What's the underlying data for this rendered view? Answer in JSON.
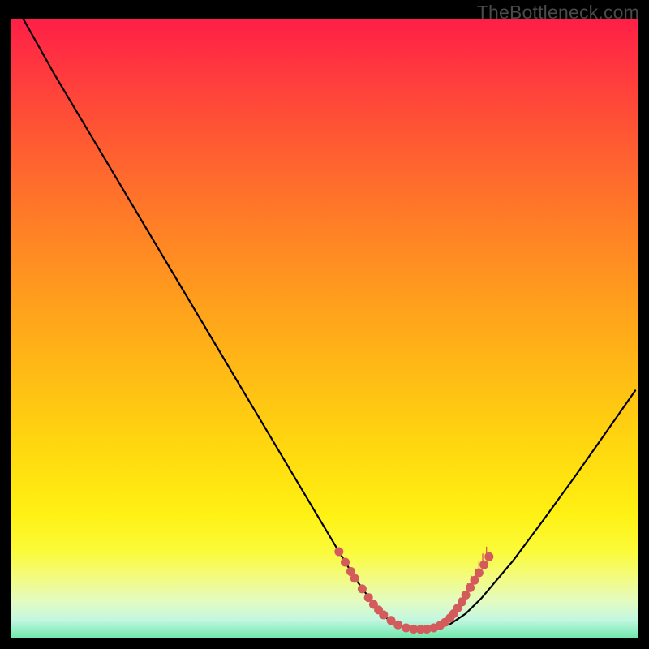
{
  "watermark": {
    "text": "TheBottleneck.com"
  },
  "chart_data": {
    "type": "line",
    "title": "",
    "xlabel": "",
    "ylabel": "",
    "xlim": [
      0,
      100
    ],
    "ylim": [
      0,
      100
    ],
    "series": [
      {
        "name": "curve",
        "x": [
          2,
          7,
          12,
          17,
          22,
          27,
          32,
          37,
          42,
          47,
          52,
          55,
          58,
          60,
          62,
          64,
          67,
          70,
          72.5,
          75,
          80,
          85,
          90,
          95,
          99.5
        ],
        "values": [
          100,
          91,
          82.5,
          74,
          65.5,
          57,
          48.5,
          40,
          31.5,
          23,
          14.5,
          9.5,
          5.3,
          3.2,
          2.0,
          1.5,
          1.5,
          2.3,
          4.0,
          6.5,
          12.5,
          19.3,
          26.3,
          33.5,
          40.0
        ]
      }
    ],
    "markers": {
      "name": "dots",
      "color": "#d45b5b",
      "points": [
        {
          "x": 52.3,
          "y": 14.0
        },
        {
          "x": 53.3,
          "y": 12.3
        },
        {
          "x": 54.2,
          "y": 10.8
        },
        {
          "x": 54.8,
          "y": 9.7
        },
        {
          "x": 56.0,
          "y": 8.0
        },
        {
          "x": 57.0,
          "y": 6.6
        },
        {
          "x": 57.8,
          "y": 5.5
        },
        {
          "x": 58.6,
          "y": 4.6
        },
        {
          "x": 59.4,
          "y": 3.8
        },
        {
          "x": 60.6,
          "y": 2.9
        },
        {
          "x": 61.7,
          "y": 2.2
        },
        {
          "x": 63.0,
          "y": 1.7
        },
        {
          "x": 64.2,
          "y": 1.5
        },
        {
          "x": 65.3,
          "y": 1.45
        },
        {
          "x": 66.3,
          "y": 1.5
        },
        {
          "x": 67.4,
          "y": 1.7
        },
        {
          "x": 68.4,
          "y": 2.1
        },
        {
          "x": 69.2,
          "y": 2.6
        },
        {
          "x": 70.0,
          "y": 3.3
        },
        {
          "x": 70.6,
          "y": 4.0
        },
        {
          "x": 71.2,
          "y": 4.9
        },
        {
          "x": 71.9,
          "y": 5.9
        },
        {
          "x": 72.5,
          "y": 7.0
        },
        {
          "x": 73.2,
          "y": 8.2
        },
        {
          "x": 73.9,
          "y": 9.4
        },
        {
          "x": 74.6,
          "y": 10.6
        },
        {
          "x": 75.4,
          "y": 11.9
        },
        {
          "x": 76.2,
          "y": 13.2
        }
      ]
    },
    "ticks": {
      "name": "vertical-ticks",
      "points": [
        {
          "x": 71.0,
          "y": 4.6,
          "h": 1.0
        },
        {
          "x": 71.6,
          "y": 5.5,
          "h": 1.1
        },
        {
          "x": 72.2,
          "y": 6.5,
          "h": 1.2
        },
        {
          "x": 72.8,
          "y": 7.6,
          "h": 1.3
        },
        {
          "x": 73.4,
          "y": 8.7,
          "h": 1.4
        },
        {
          "x": 74.0,
          "y": 9.8,
          "h": 1.5
        },
        {
          "x": 74.6,
          "y": 10.9,
          "h": 1.6
        },
        {
          "x": 75.2,
          "y": 12.0,
          "h": 1.7
        },
        {
          "x": 75.8,
          "y": 13.0,
          "h": 1.8
        }
      ]
    }
  }
}
